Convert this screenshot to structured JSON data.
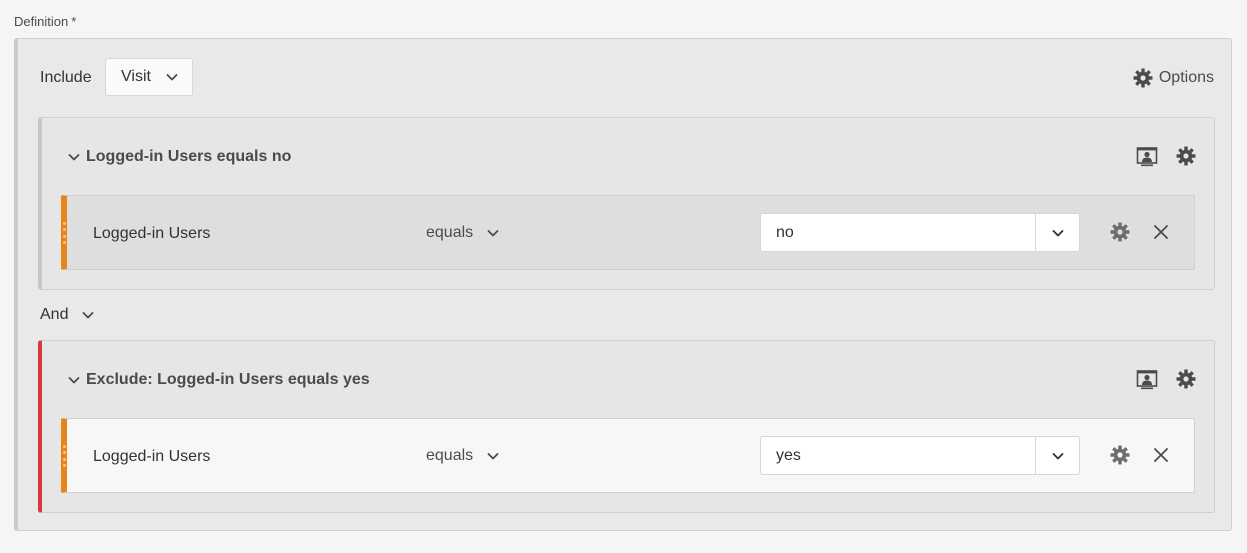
{
  "definition": {
    "label": "Definition",
    "required_mark": "*"
  },
  "header": {
    "include_label": "Include",
    "scope_value": "Visit",
    "options_label": "Options"
  },
  "containers": [
    {
      "title": "Logged-in Users equals no",
      "rule": {
        "dimension": "Logged-in Users",
        "operator": "equals",
        "value": "no"
      }
    },
    {
      "title": "Exclude: Logged-in Users equals yes",
      "rule": {
        "dimension": "Logged-in Users",
        "operator": "equals",
        "value": "yes"
      }
    }
  ],
  "logic": {
    "operator_label": "And"
  },
  "colors": {
    "accent_orange": "#e68619",
    "exclude_red": "#d7373f",
    "background": "#f5f5f5"
  },
  "icons": [
    "chevron-down-icon",
    "gear-icon",
    "screen-user-icon",
    "close-icon",
    "drag-grip-icon"
  ]
}
